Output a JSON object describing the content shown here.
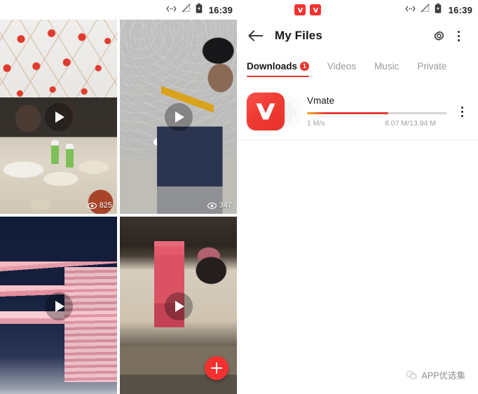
{
  "left_panel": {
    "name": "vmate-feed",
    "status_bar": {
      "time": "16:39",
      "icons": [
        "usb-data-icon",
        "signal-off-icon",
        "battery-charging-icon"
      ]
    },
    "videos": [
      {
        "id": "video-1",
        "view_count": "825",
        "play_icon": "play-icon",
        "eye_icon": "eye-icon"
      },
      {
        "id": "video-2",
        "view_count": "347",
        "play_icon": "play-icon",
        "eye_icon": "eye-icon"
      },
      {
        "id": "video-3",
        "view_count": "",
        "play_icon": "play-icon",
        "eye_icon": "eye-icon"
      },
      {
        "id": "video-4",
        "view_count": "",
        "play_icon": "play-icon",
        "eye_icon": "eye-icon"
      }
    ],
    "fab": {
      "icon": "plus-icon",
      "color": "#f4312f"
    }
  },
  "right_panel": {
    "name": "my-files",
    "status_bar": {
      "time": "16:39",
      "notification_icons": [
        "vmate-notification-icon",
        "vmate-notification-icon"
      ],
      "icons": [
        "usb-data-icon",
        "signal-off-icon",
        "battery-charging-icon"
      ]
    },
    "appbar": {
      "back_icon": "back-arrow-icon",
      "title": "My Files",
      "settings_icon": "gear-icon",
      "overflow_icon": "more-vertical-icon"
    },
    "tabs": [
      {
        "label": "Downloads",
        "active": true,
        "badge": "1"
      },
      {
        "label": "Videos",
        "active": false,
        "badge": ""
      },
      {
        "label": "Music",
        "active": false,
        "badge": ""
      },
      {
        "label": "Private",
        "active": false,
        "badge": ""
      }
    ],
    "downloads": [
      {
        "name": "Vmate",
        "icon": "vmate-app-icon",
        "background_icon": "android-robot-icon",
        "speed": "1 M/s",
        "size": "8.07 M/13.94 M",
        "progress_percent": 58,
        "overflow_icon": "more-vertical-icon"
      }
    ]
  },
  "watermark": {
    "icon": "wechat-icon",
    "text": "APP优选集"
  },
  "colors": {
    "accent_red": "#e8342c",
    "fab_red": "#f4312f",
    "progress_orange": "#f5a623",
    "track_gray": "#d6d6d6",
    "inactive_tab": "#9b9b9e"
  }
}
